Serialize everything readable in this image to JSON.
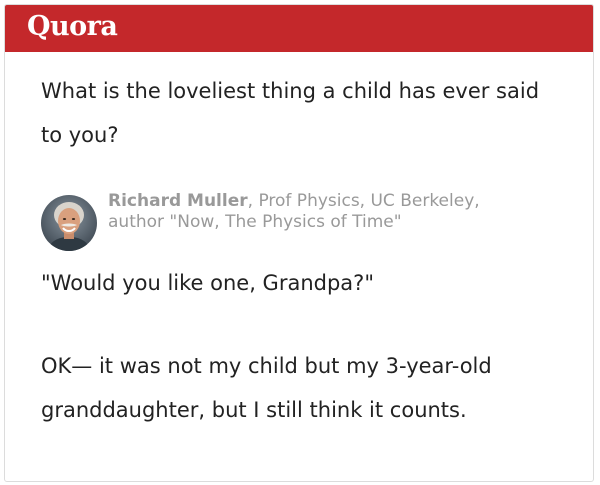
{
  "header": {
    "logo_text": "Quora",
    "brand_color": "#c4282b"
  },
  "question": {
    "title": "What is the loveliest thing a child has ever said to you?"
  },
  "author": {
    "avatar_icon": "avatar-photo",
    "name": "Richard Muller",
    "separator": ", ",
    "credentials": "Prof Physics, UC Berkeley, author \"Now, The Physics of Time\""
  },
  "answer": {
    "quote": "\"Would you like one, Grandpa?\"",
    "body": "OK— it was not my child but my 3-year-old granddaughter, but I still think it counts."
  }
}
